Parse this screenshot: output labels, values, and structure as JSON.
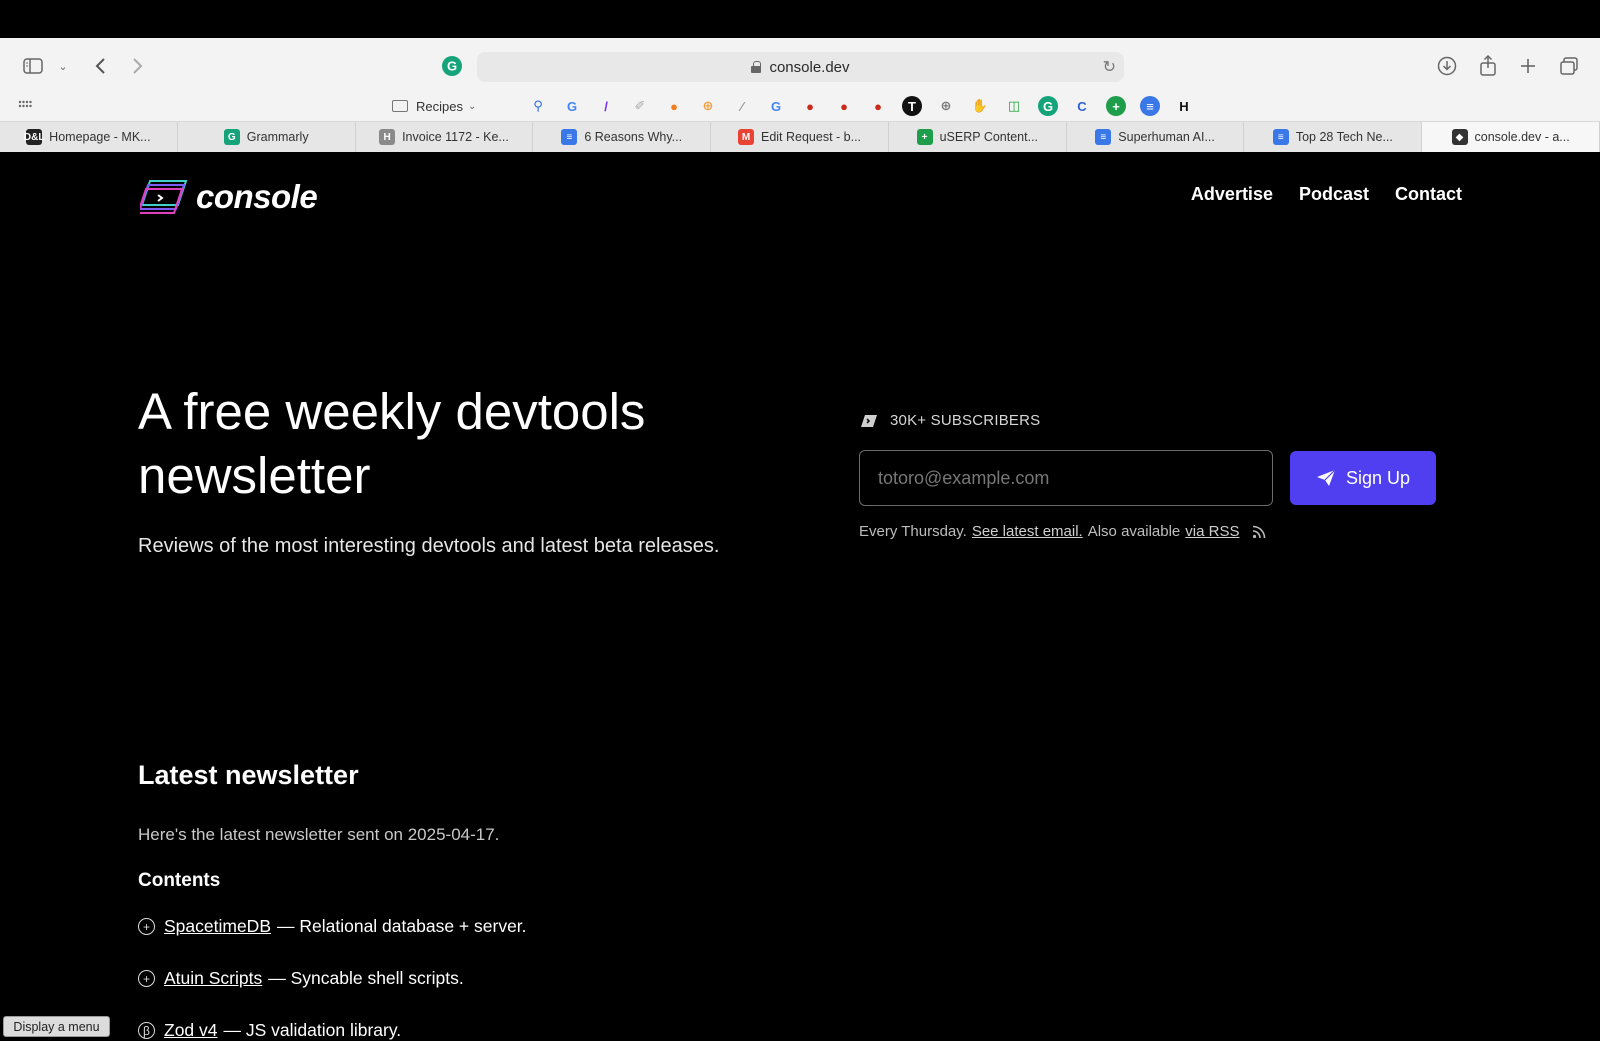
{
  "browser": {
    "address": "console.dev",
    "bookmarks_folder": "Recipes",
    "bookmark_icons": [
      {
        "name": "apple-icon",
        "glyph": "",
        "color": "#111",
        "bg": "transparent"
      },
      {
        "name": "search-icon",
        "glyph": "⚲",
        "color": "#2f6de1",
        "bg": "transparent"
      },
      {
        "name": "google-icon",
        "glyph": "G",
        "color": "#4285f4",
        "bg": "transparent"
      },
      {
        "name": "slash-icon",
        "glyph": "/",
        "color": "#7b2cf5",
        "bg": "transparent"
      },
      {
        "name": "script-icon",
        "glyph": "✐",
        "color": "#aaa",
        "bg": "transparent"
      },
      {
        "name": "orange-icon",
        "glyph": "●",
        "color": "#f0801f",
        "bg": "transparent"
      },
      {
        "name": "orbit-icon",
        "glyph": "⊕",
        "color": "#f0a040",
        "bg": "transparent"
      },
      {
        "name": "feather-icon",
        "glyph": "⁄",
        "color": "#999",
        "bg": "transparent"
      },
      {
        "name": "google-icon-2",
        "glyph": "G",
        "color": "#4285f4",
        "bg": "transparent"
      },
      {
        "name": "disc-icon-1",
        "glyph": "●",
        "color": "#c92a1a",
        "bg": "transparent"
      },
      {
        "name": "disc-icon-2",
        "glyph": "●",
        "color": "#c92a1a",
        "bg": "transparent"
      },
      {
        "name": "disc-icon-3",
        "glyph": "●",
        "color": "#c92a1a",
        "bg": "transparent"
      },
      {
        "name": "t-icon",
        "glyph": "T",
        "color": "#fff",
        "bg": "#111"
      },
      {
        "name": "globe-icon",
        "glyph": "⊕",
        "color": "#777",
        "bg": "transparent"
      },
      {
        "name": "hand-icon",
        "glyph": "✋",
        "color": "#e89a9a",
        "bg": "transparent"
      },
      {
        "name": "copy-icon",
        "glyph": "◫",
        "color": "#22a33a",
        "bg": "transparent"
      },
      {
        "name": "grammarly-icon",
        "glyph": "G",
        "color": "#fff",
        "bg": "#15a37a"
      },
      {
        "name": "c-icon",
        "glyph": "C",
        "color": "#2f5fd1",
        "bg": "transparent"
      },
      {
        "name": "sheets-icon",
        "glyph": "+",
        "color": "#fff",
        "bg": "#1e9e4a"
      },
      {
        "name": "docs-icon",
        "glyph": "≡",
        "color": "#fff",
        "bg": "#3b78e7"
      },
      {
        "name": "h-icon",
        "glyph": "H",
        "color": "#111",
        "bg": "transparent"
      }
    ],
    "tabs": [
      {
        "label": "Homepage - MK...",
        "fav": "D&L",
        "fav_bg": "#222"
      },
      {
        "label": "Grammarly",
        "fav": "G",
        "fav_bg": "#15a37a"
      },
      {
        "label": "Invoice 1172 - Ke...",
        "fav": "H",
        "fav_bg": "#8a8a8a"
      },
      {
        "label": "6 Reasons Why...",
        "fav": "≡",
        "fav_bg": "#3b78e7"
      },
      {
        "label": "Edit Request - b...",
        "fav": "M",
        "fav_bg": "#ea4335"
      },
      {
        "label": "uSERP Content...",
        "fav": "+",
        "fav_bg": "#1e9e4a"
      },
      {
        "label": "Superhuman AI...",
        "fav": "≡",
        "fav_bg": "#3b78e7"
      },
      {
        "label": "Top 28 Tech Ne...",
        "fav": "≡",
        "fav_bg": "#3b78e7"
      },
      {
        "label": "console.dev - a...",
        "fav": "◆",
        "fav_bg": "#333"
      }
    ]
  },
  "site": {
    "logo_text": "console",
    "nav": [
      "Advertise",
      "Podcast",
      "Contact"
    ],
    "hero_title": "A free weekly devtools newsletter",
    "hero_subtitle": "Reviews of the most interesting devtools and latest beta releases.",
    "subscribers": "30K+ SUBSCRIBERS",
    "email_placeholder": "totoro@example.com",
    "signup_label": "Sign Up",
    "every_prefix": "Every Thursday.",
    "see_latest": "See latest email.",
    "also": "Also available",
    "via_rss": "via RSS",
    "latest_heading": "Latest newsletter",
    "latest_text": "Here's the latest newsletter sent on 2025-04-17.",
    "contents_heading": "Contents",
    "items": [
      {
        "symbol": "+",
        "link": "SpacetimeDB",
        "desc": "— Relational database + server."
      },
      {
        "symbol": "+",
        "link": "Atuin Scripts",
        "desc": "— Syncable shell scripts."
      },
      {
        "symbol": "β",
        "link": "Zod v4",
        "desc": "— JS validation library."
      }
    ]
  },
  "status_tooltip": "Display a menu"
}
